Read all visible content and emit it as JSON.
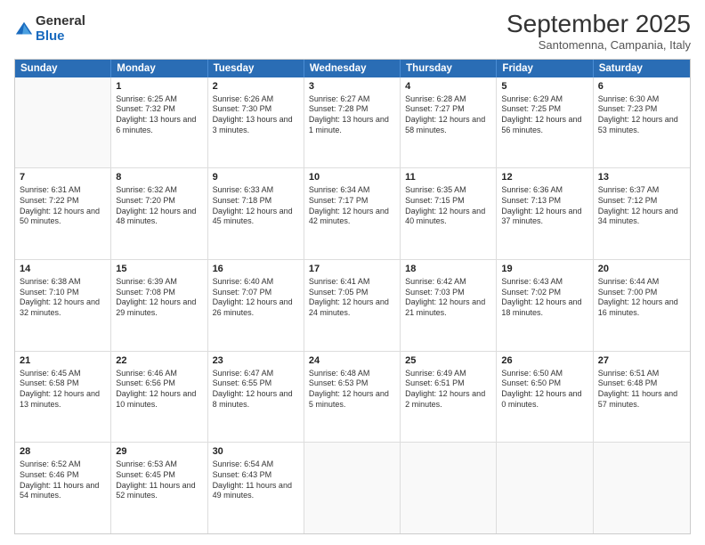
{
  "logo": {
    "general": "General",
    "blue": "Blue"
  },
  "header": {
    "month": "September 2025",
    "location": "Santomenna, Campania, Italy"
  },
  "weekdays": [
    "Sunday",
    "Monday",
    "Tuesday",
    "Wednesday",
    "Thursday",
    "Friday",
    "Saturday"
  ],
  "rows": [
    [
      {
        "day": "",
        "sunrise": "",
        "sunset": "",
        "daylight": ""
      },
      {
        "day": "1",
        "sunrise": "Sunrise: 6:25 AM",
        "sunset": "Sunset: 7:32 PM",
        "daylight": "Daylight: 13 hours and 6 minutes."
      },
      {
        "day": "2",
        "sunrise": "Sunrise: 6:26 AM",
        "sunset": "Sunset: 7:30 PM",
        "daylight": "Daylight: 13 hours and 3 minutes."
      },
      {
        "day": "3",
        "sunrise": "Sunrise: 6:27 AM",
        "sunset": "Sunset: 7:28 PM",
        "daylight": "Daylight: 13 hours and 1 minute."
      },
      {
        "day": "4",
        "sunrise": "Sunrise: 6:28 AM",
        "sunset": "Sunset: 7:27 PM",
        "daylight": "Daylight: 12 hours and 58 minutes."
      },
      {
        "day": "5",
        "sunrise": "Sunrise: 6:29 AM",
        "sunset": "Sunset: 7:25 PM",
        "daylight": "Daylight: 12 hours and 56 minutes."
      },
      {
        "day": "6",
        "sunrise": "Sunrise: 6:30 AM",
        "sunset": "Sunset: 7:23 PM",
        "daylight": "Daylight: 12 hours and 53 minutes."
      }
    ],
    [
      {
        "day": "7",
        "sunrise": "Sunrise: 6:31 AM",
        "sunset": "Sunset: 7:22 PM",
        "daylight": "Daylight: 12 hours and 50 minutes."
      },
      {
        "day": "8",
        "sunrise": "Sunrise: 6:32 AM",
        "sunset": "Sunset: 7:20 PM",
        "daylight": "Daylight: 12 hours and 48 minutes."
      },
      {
        "day": "9",
        "sunrise": "Sunrise: 6:33 AM",
        "sunset": "Sunset: 7:18 PM",
        "daylight": "Daylight: 12 hours and 45 minutes."
      },
      {
        "day": "10",
        "sunrise": "Sunrise: 6:34 AM",
        "sunset": "Sunset: 7:17 PM",
        "daylight": "Daylight: 12 hours and 42 minutes."
      },
      {
        "day": "11",
        "sunrise": "Sunrise: 6:35 AM",
        "sunset": "Sunset: 7:15 PM",
        "daylight": "Daylight: 12 hours and 40 minutes."
      },
      {
        "day": "12",
        "sunrise": "Sunrise: 6:36 AM",
        "sunset": "Sunset: 7:13 PM",
        "daylight": "Daylight: 12 hours and 37 minutes."
      },
      {
        "day": "13",
        "sunrise": "Sunrise: 6:37 AM",
        "sunset": "Sunset: 7:12 PM",
        "daylight": "Daylight: 12 hours and 34 minutes."
      }
    ],
    [
      {
        "day": "14",
        "sunrise": "Sunrise: 6:38 AM",
        "sunset": "Sunset: 7:10 PM",
        "daylight": "Daylight: 12 hours and 32 minutes."
      },
      {
        "day": "15",
        "sunrise": "Sunrise: 6:39 AM",
        "sunset": "Sunset: 7:08 PM",
        "daylight": "Daylight: 12 hours and 29 minutes."
      },
      {
        "day": "16",
        "sunrise": "Sunrise: 6:40 AM",
        "sunset": "Sunset: 7:07 PM",
        "daylight": "Daylight: 12 hours and 26 minutes."
      },
      {
        "day": "17",
        "sunrise": "Sunrise: 6:41 AM",
        "sunset": "Sunset: 7:05 PM",
        "daylight": "Daylight: 12 hours and 24 minutes."
      },
      {
        "day": "18",
        "sunrise": "Sunrise: 6:42 AM",
        "sunset": "Sunset: 7:03 PM",
        "daylight": "Daylight: 12 hours and 21 minutes."
      },
      {
        "day": "19",
        "sunrise": "Sunrise: 6:43 AM",
        "sunset": "Sunset: 7:02 PM",
        "daylight": "Daylight: 12 hours and 18 minutes."
      },
      {
        "day": "20",
        "sunrise": "Sunrise: 6:44 AM",
        "sunset": "Sunset: 7:00 PM",
        "daylight": "Daylight: 12 hours and 16 minutes."
      }
    ],
    [
      {
        "day": "21",
        "sunrise": "Sunrise: 6:45 AM",
        "sunset": "Sunset: 6:58 PM",
        "daylight": "Daylight: 12 hours and 13 minutes."
      },
      {
        "day": "22",
        "sunrise": "Sunrise: 6:46 AM",
        "sunset": "Sunset: 6:56 PM",
        "daylight": "Daylight: 12 hours and 10 minutes."
      },
      {
        "day": "23",
        "sunrise": "Sunrise: 6:47 AM",
        "sunset": "Sunset: 6:55 PM",
        "daylight": "Daylight: 12 hours and 8 minutes."
      },
      {
        "day": "24",
        "sunrise": "Sunrise: 6:48 AM",
        "sunset": "Sunset: 6:53 PM",
        "daylight": "Daylight: 12 hours and 5 minutes."
      },
      {
        "day": "25",
        "sunrise": "Sunrise: 6:49 AM",
        "sunset": "Sunset: 6:51 PM",
        "daylight": "Daylight: 12 hours and 2 minutes."
      },
      {
        "day": "26",
        "sunrise": "Sunrise: 6:50 AM",
        "sunset": "Sunset: 6:50 PM",
        "daylight": "Daylight: 12 hours and 0 minutes."
      },
      {
        "day": "27",
        "sunrise": "Sunrise: 6:51 AM",
        "sunset": "Sunset: 6:48 PM",
        "daylight": "Daylight: 11 hours and 57 minutes."
      }
    ],
    [
      {
        "day": "28",
        "sunrise": "Sunrise: 6:52 AM",
        "sunset": "Sunset: 6:46 PM",
        "daylight": "Daylight: 11 hours and 54 minutes."
      },
      {
        "day": "29",
        "sunrise": "Sunrise: 6:53 AM",
        "sunset": "Sunset: 6:45 PM",
        "daylight": "Daylight: 11 hours and 52 minutes."
      },
      {
        "day": "30",
        "sunrise": "Sunrise: 6:54 AM",
        "sunset": "Sunset: 6:43 PM",
        "daylight": "Daylight: 11 hours and 49 minutes."
      },
      {
        "day": "",
        "sunrise": "",
        "sunset": "",
        "daylight": ""
      },
      {
        "day": "",
        "sunrise": "",
        "sunset": "",
        "daylight": ""
      },
      {
        "day": "",
        "sunrise": "",
        "sunset": "",
        "daylight": ""
      },
      {
        "day": "",
        "sunrise": "",
        "sunset": "",
        "daylight": ""
      }
    ]
  ]
}
